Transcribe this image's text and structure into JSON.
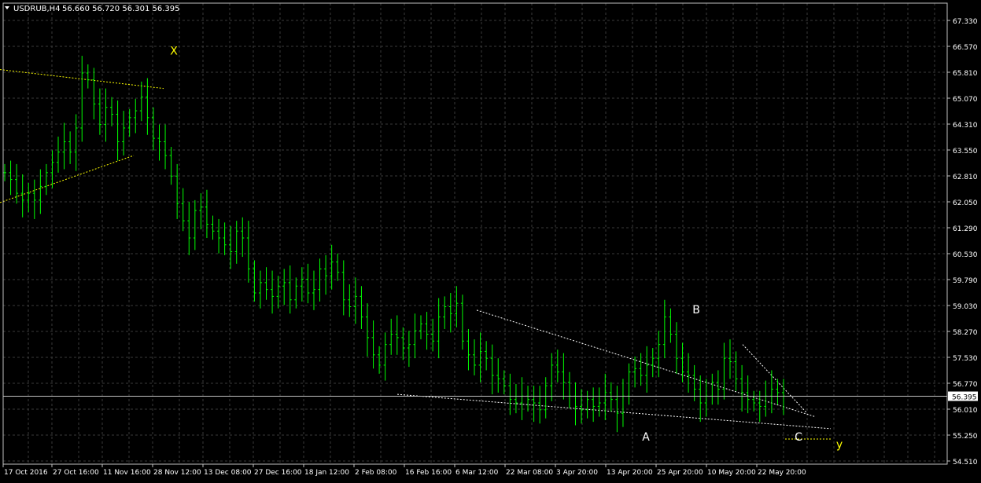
{
  "header": {
    "menu_icon": "triangle-down-icon",
    "symbol": "USDRUB,H4",
    "ohlc": "56.660 56.720 56.301 56.395"
  },
  "colors": {
    "background": "#000000",
    "grid": "#3a3a3a",
    "candles": "#00ff00",
    "axis_text": "#ffffff",
    "price_line": "#c0c0c0",
    "price_box": "#ffffff",
    "trendlines": "#ffffff",
    "trendlines_xy": "#ffff00",
    "label_xy": "#ffff00",
    "label_abc": "#ffffff"
  },
  "chart_data": {
    "type": "candlestick",
    "symbol": "USDRUB",
    "timeframe": "H4",
    "x_ticks": [
      "17 Oct 2016",
      "27 Oct 16:00",
      "11 Nov 16:00",
      "28 Nov 12:00",
      "13 Dec 08:00",
      "27 Dec 16:00",
      "18 Jan 12:00",
      "2 Feb 08:00",
      "16 Feb 16:00",
      "6 Mar 12:00",
      "22 Mar 08:00",
      "3 Apr 20:00",
      "13 Apr 20:00",
      "25 Apr 20:00",
      "10 May 20:00",
      "22 May 20:00"
    ],
    "y_ticks": [
      "67.330",
      "66.570",
      "65.810",
      "65.070",
      "64.310",
      "63.550",
      "62.810",
      "62.050",
      "61.290",
      "60.530",
      "59.790",
      "59.030",
      "58.270",
      "57.530",
      "56.770",
      "56.010",
      "55.250",
      "54.510"
    ],
    "ylim": [
      54.51,
      67.33
    ],
    "grid": true,
    "current_price": "56.395",
    "close_series": [
      62.9,
      62.7,
      62.3,
      62.1,
      62.3,
      62.1,
      62.5,
      62.9,
      63.2,
      63.5,
      63.8,
      63.5,
      64.2,
      65.8,
      65.6,
      64.9,
      64.3,
      64.8,
      64.6,
      63.8,
      64.2,
      64.5,
      64.7,
      65.1,
      64.5,
      63.9,
      63.8,
      63.4,
      62.8,
      62.0,
      61.5,
      61.0,
      61.8,
      61.9,
      61.4,
      61.2,
      61.0,
      60.8,
      60.6,
      61.2,
      61.0,
      60.1,
      59.4,
      59.7,
      59.5,
      59.3,
      59.6,
      59.7,
      59.2,
      59.6,
      59.8,
      59.4,
      59.5,
      60.1,
      59.9,
      60.3,
      60.0,
      59.2,
      59.0,
      59.3,
      58.7,
      58.1,
      57.6,
      57.3,
      57.9,
      58.2,
      58.1,
      57.8,
      57.9,
      58.3,
      58.5,
      58.2,
      58.0,
      58.7,
      59.0,
      58.8,
      59.1,
      58.0,
      57.6,
      57.3,
      57.7,
      57.5,
      57.0,
      56.9,
      56.7,
      56.3,
      56.2,
      56.4,
      56.3,
      56.2,
      56.0,
      56.7,
      57.3,
      57.1,
      56.8,
      56.4,
      56.1,
      56.0,
      56.3,
      56.1,
      56.2,
      56.5,
      56.3,
      55.9,
      56.4,
      57.1,
      57.2,
      57.0,
      57.3,
      57.5,
      57.9,
      58.7,
      58.2,
      57.5,
      57.1,
      57.0,
      56.6,
      56.2,
      56.4,
      56.8,
      56.6,
      57.5,
      57.4,
      56.9,
      56.5,
      56.3,
      56.2,
      56.1,
      56.4,
      56.6,
      56.5,
      56.4
    ],
    "trendlines": [
      {
        "name": "x-top",
        "points": [
          [
            "17 Oct 2016",
            65.9
          ],
          [
            "28 Nov 12:00",
            65.35
          ]
        ],
        "color": "yellow"
      },
      {
        "name": "x-bottom",
        "points": [
          [
            "17 Oct 2016",
            62.03
          ],
          [
            "11 Nov 16:00",
            63.4
          ]
        ],
        "color": "yellow"
      },
      {
        "name": "c-upper",
        "points": [
          [
            "6 Mar 12:00",
            58.9
          ],
          [
            "22 May 20:00",
            55.8
          ]
        ],
        "color": "white"
      },
      {
        "name": "c-lower",
        "points": [
          [
            "16 Feb 16:00",
            56.45
          ],
          [
            "22 May 20:00",
            55.45
          ]
        ],
        "color": "white"
      },
      {
        "name": "c2-upper",
        "points": [
          [
            "10 May 20:00",
            57.9
          ],
          [
            "22 May 20:00",
            55.9
          ]
        ],
        "color": "white"
      },
      {
        "name": "y-target",
        "points": [
          [
            "22 May 20:00",
            55.15
          ],
          [
            "22 May 20:00",
            55.15
          ]
        ],
        "color": "yellow"
      }
    ],
    "wave_labels": [
      {
        "text": "X",
        "price": 66.45
      },
      {
        "text": "A",
        "price": 55.22
      },
      {
        "text": "B",
        "price": 58.92
      },
      {
        "text": "C",
        "price": 55.22
      },
      {
        "text": "y",
        "price": 55.0
      }
    ]
  }
}
